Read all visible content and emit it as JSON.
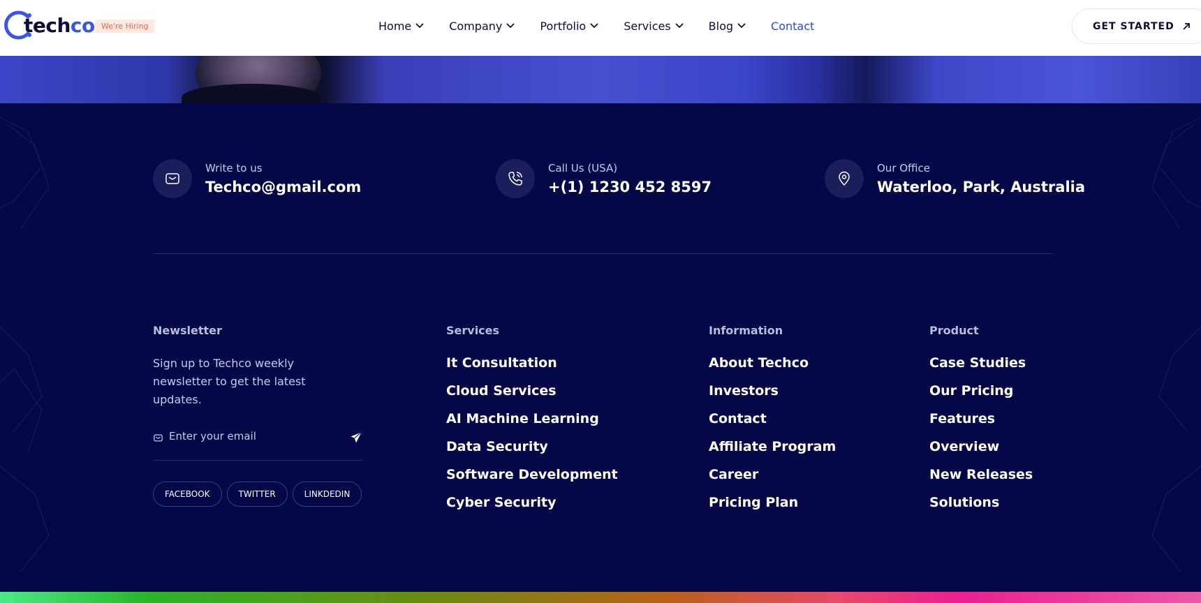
{
  "header": {
    "logo": {
      "prefix": "tech",
      "suffix": "co"
    },
    "hiring_badge": "We're Hiring",
    "nav": [
      {
        "label": "Home",
        "has_dropdown": true
      },
      {
        "label": "Company",
        "has_dropdown": true
      },
      {
        "label": "Portfolio",
        "has_dropdown": true
      },
      {
        "label": "Services",
        "has_dropdown": true
      },
      {
        "label": "Blog",
        "has_dropdown": true
      },
      {
        "label": "Contact",
        "has_dropdown": false,
        "active": true
      }
    ],
    "cta_label": "GET STARTED"
  },
  "contacts": [
    {
      "label": "Write to us",
      "value": "Techco@gmail.com",
      "icon": "mail-icon"
    },
    {
      "label": "Call Us (USA)",
      "value": "+(1) 1230 452 8597",
      "icon": "phone-icon"
    },
    {
      "label": "Our Office",
      "value": "Waterloo, Park, Australia",
      "icon": "location-pin-icon"
    }
  ],
  "newsletter": {
    "title": "Newsletter",
    "text": "Sign up to Techco weekly newsletter to get the latest updates.",
    "placeholder": "Enter your email",
    "socials": [
      "FACEBOOK",
      "TWITTER",
      "LINKDEDIN"
    ]
  },
  "columns": {
    "services": {
      "title": "Services",
      "links": [
        "It Consultation",
        "Cloud Services",
        "AI Machine Learning",
        "Data Security",
        "Software Development",
        "Cyber Security"
      ]
    },
    "information": {
      "title": "Information",
      "links": [
        "About Techco",
        "Investors",
        "Contact",
        "Affiliate Program",
        "Career",
        "Pricing Plan"
      ]
    },
    "product": {
      "title": "Product",
      "links": [
        "Case Studies",
        "Our Pricing",
        "Features",
        "Overview",
        "New Releases",
        "Solutions"
      ]
    }
  },
  "colors": {
    "accent": "#2f4ad8",
    "footer_bg": "#040847",
    "hiring": "#e8684a"
  }
}
